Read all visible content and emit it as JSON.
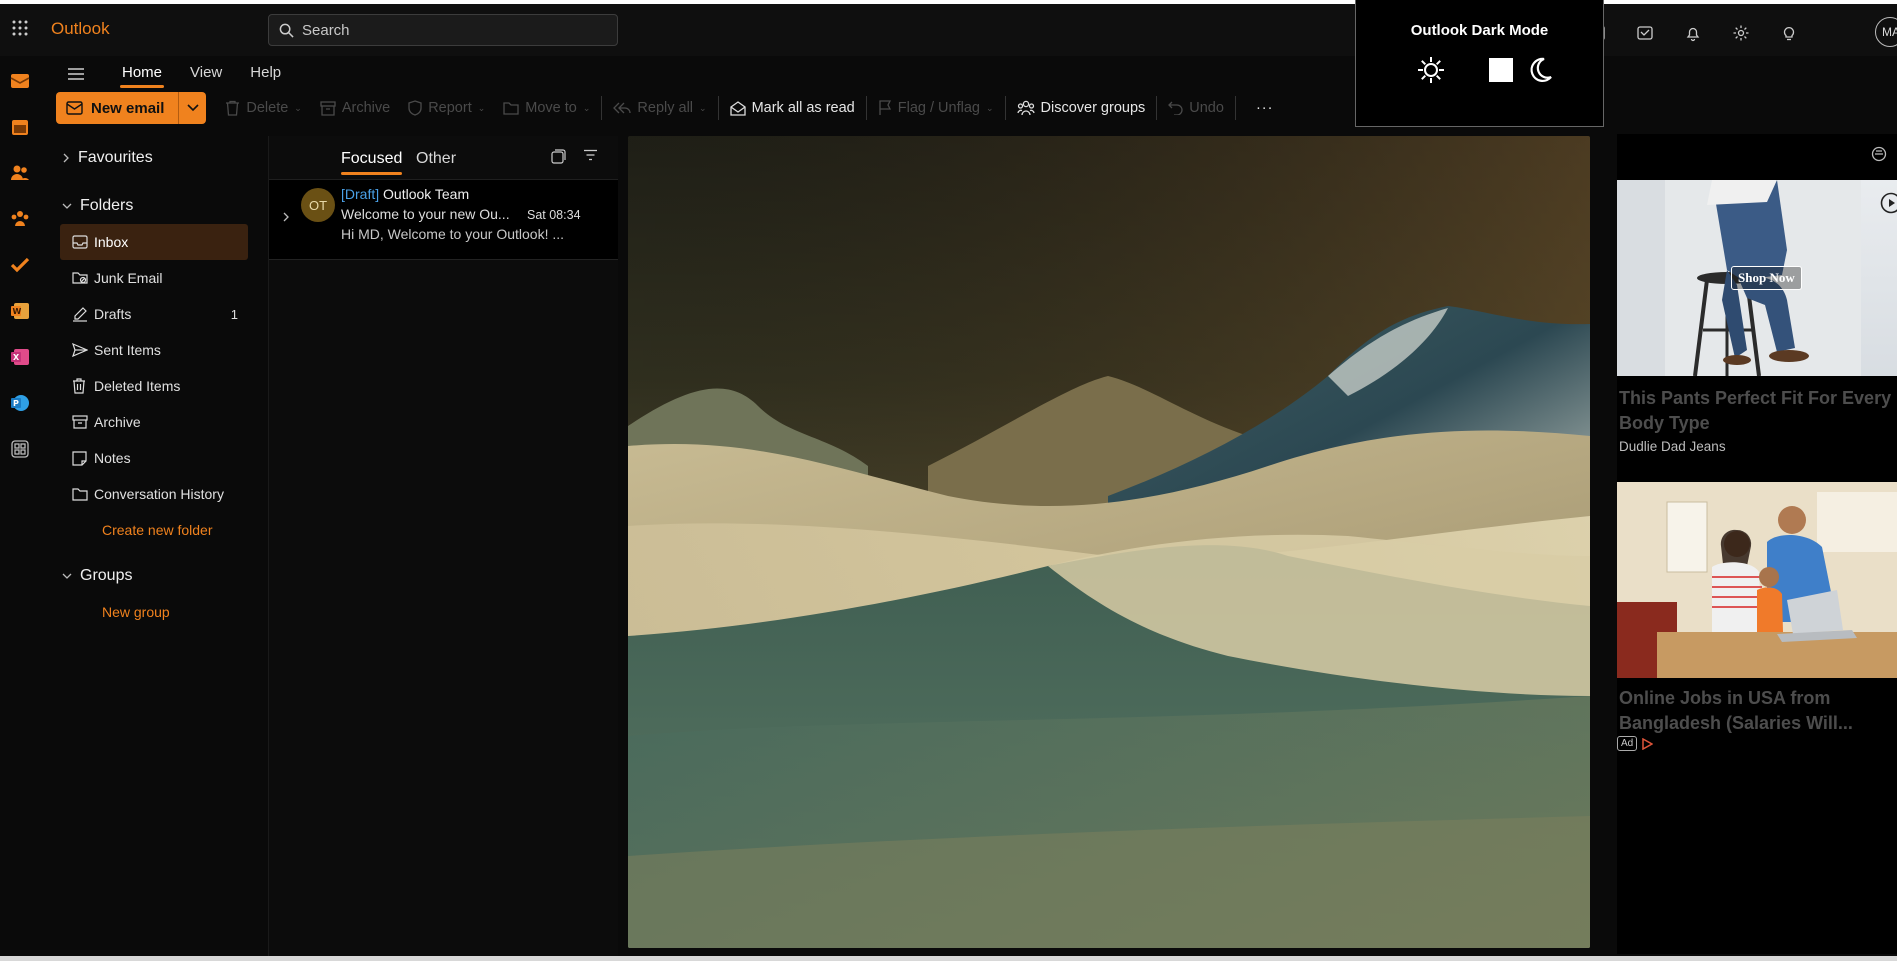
{
  "app": {
    "brand": "Outlook"
  },
  "search": {
    "placeholder": "Search"
  },
  "user": {
    "initials": "MA"
  },
  "dark_mode": {
    "title": "Outlook Dark Mode"
  },
  "nav_tabs": [
    "Home",
    "View",
    "Help"
  ],
  "ribbon": {
    "new_email": "New email",
    "delete": "Delete",
    "archive": "Archive",
    "report": "Report",
    "move_to": "Move to",
    "reply_all": "Reply all",
    "mark_all_read": "Mark all as read",
    "flag_unflag": "Flag / Unflag",
    "discover_groups": "Discover groups",
    "undo": "Undo",
    "more": "···"
  },
  "folder_pane": {
    "favourites": "Favourites",
    "folders_header": "Folders",
    "folders": [
      {
        "label": "Inbox",
        "icon": "inbox-icon",
        "count": ""
      },
      {
        "label": "Junk Email",
        "icon": "junk-icon",
        "count": ""
      },
      {
        "label": "Drafts",
        "icon": "drafts-icon",
        "count": "1"
      },
      {
        "label": "Sent Items",
        "icon": "send-icon",
        "count": ""
      },
      {
        "label": "Deleted Items",
        "icon": "trash-icon",
        "count": ""
      },
      {
        "label": "Archive",
        "icon": "archive-icon",
        "count": ""
      },
      {
        "label": "Notes",
        "icon": "notes-icon",
        "count": ""
      },
      {
        "label": "Conversation History",
        "icon": "folder-icon",
        "count": ""
      }
    ],
    "create_folder": "Create new folder",
    "groups_header": "Groups",
    "new_group": "New group"
  },
  "message_list": {
    "tabs": [
      "Focused",
      "Other"
    ],
    "messages": [
      {
        "initials": "OT",
        "draft_tag": "[Draft]",
        "sender": "Outlook Team",
        "subject": "Welcome to your new Ou...",
        "time": "Sat 08:34",
        "preview": "Hi MD, Welcome to your Outlook! ..."
      }
    ]
  },
  "ads": [
    {
      "cta": "Shop Now",
      "title_line1": "This Pants Perfect Fit For Every",
      "title_line2": "Body Type",
      "sponsor": "Dudlie Dad Jeans"
    },
    {
      "title_line1": "Online Jobs in USA from",
      "title_line2": "Bangladesh (Salaries Will...",
      "badge": "Ad"
    }
  ],
  "colors": {
    "accent": "#f0821e",
    "draft": "#4aa0e6",
    "background": "#0a0a0a"
  }
}
